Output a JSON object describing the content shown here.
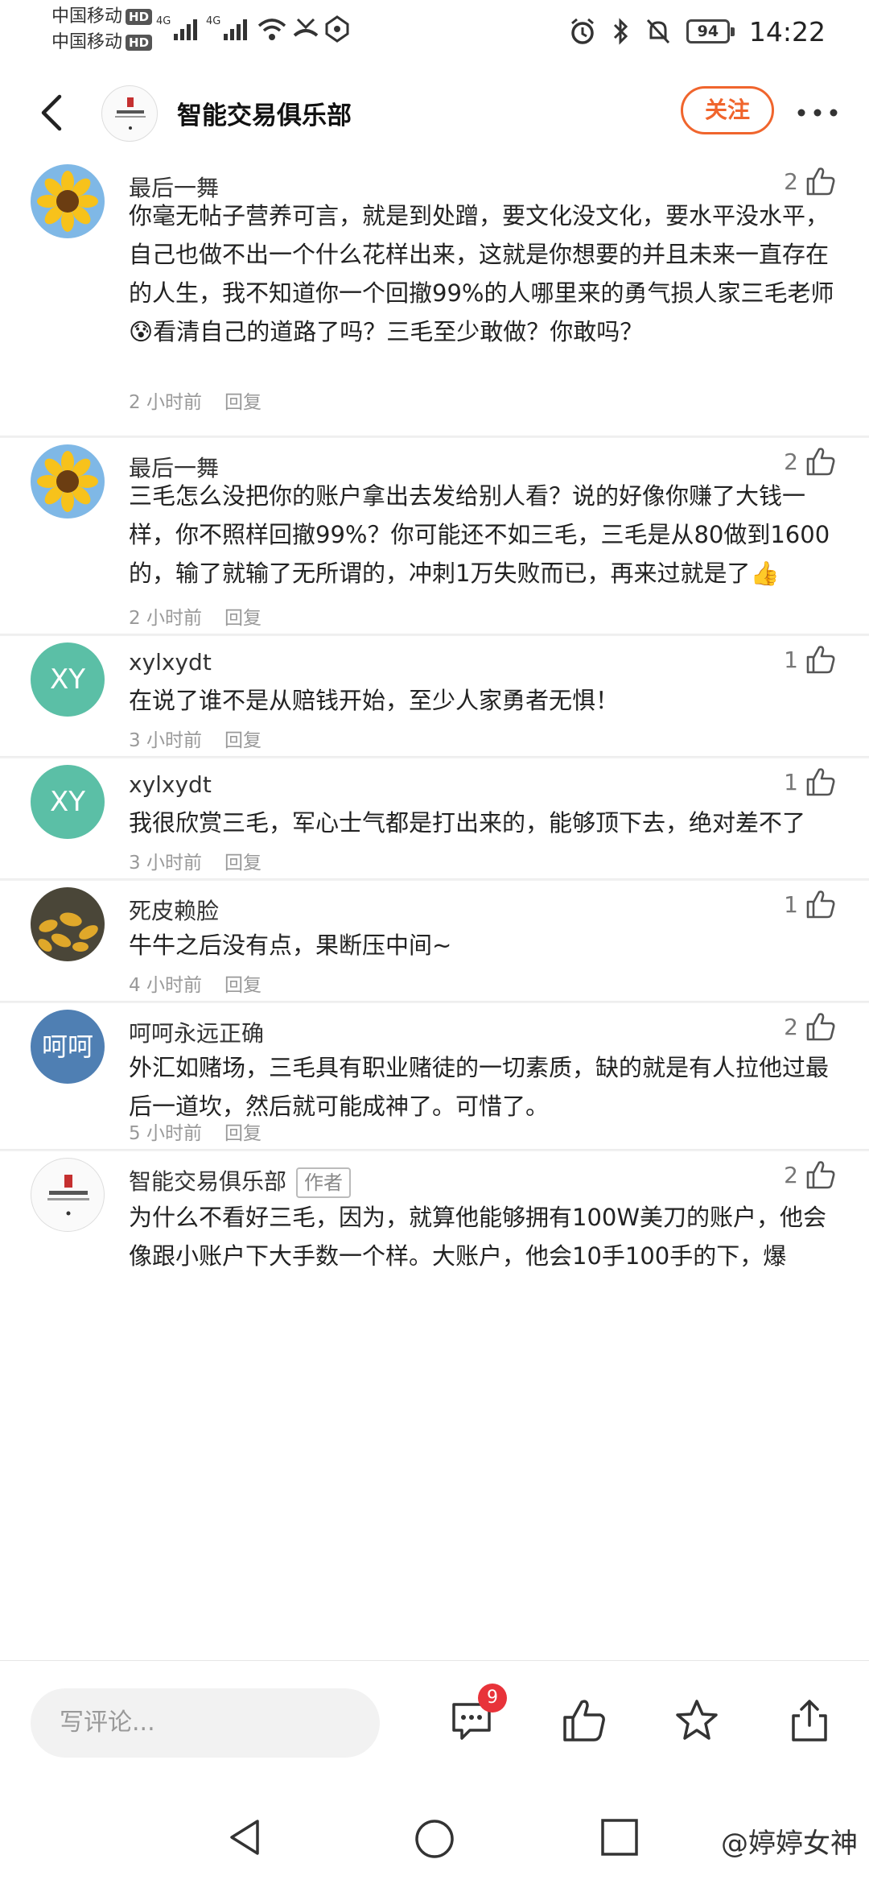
{
  "status_bar": {
    "carrier_1": "中国移动",
    "carrier_2": "中国移动",
    "hd_label": "HD",
    "network_1": "4G",
    "network_2": "4G",
    "battery": "94",
    "time": "14:22"
  },
  "header": {
    "title": "智能交易俱乐部",
    "follow_label": "关注",
    "accent_color": "#f0652d"
  },
  "comments": [
    {
      "user": "最后一舞",
      "likes": "2",
      "text": "你毫无帖子营养可言，就是到处蹭，要文化没文化，要水平没水平，自己也做不出一个什么花样出来，这就是你想要的并且未来一直存在的人生，我不知道你一个回撤99%的人哪里来的勇气损人家三毛老师😰看清自己的道路了吗？三毛至少敢做？你敢吗？",
      "time": "2 小时前",
      "reply": "回复"
    },
    {
      "user": "最后一舞",
      "likes": "2",
      "text": "三毛怎么没把你的账户拿出去发给别人看？说的好像你赚了大钱一样，你不照样回撤99%？你可能还不如三毛，三毛是从80做到1600的，输了就输了无所谓的，冲刺1万失败而已，再来过就是了👍",
      "time": "2 小时前",
      "reply": "回复"
    },
    {
      "user": "xylxydt",
      "avatar_text": "XY",
      "likes": "1",
      "text": "在说了谁不是从赔钱开始，至少人家勇者无惧！",
      "time": "3 小时前",
      "reply": "回复"
    },
    {
      "user": "xylxydt",
      "avatar_text": "XY",
      "likes": "1",
      "text": "我很欣赏三毛，军心士气都是打出来的，能够顶下去，绝对差不了",
      "time": "3 小时前",
      "reply": "回复"
    },
    {
      "user": "死皮赖脸",
      "likes": "1",
      "text": "牛牛之后没有点，果断压中间~",
      "time": "4 小时前",
      "reply": "回复"
    },
    {
      "user": "呵呵永远正确",
      "avatar_text": "呵呵",
      "likes": "2",
      "text": "外汇如赌场，三毛具有职业赌徒的一切素质，缺的就是有人拉他过最后一道坎，然后就可能成神了。可惜了。",
      "time": "5 小时前",
      "reply": "回复"
    },
    {
      "user": "智能交易俱乐部",
      "tag": "作者",
      "likes": "2",
      "text": "为什么不看好三毛，因为，就算他能够拥有100W美刀的账户，他会像跟小账户下大手数一个样。大账户，他会10手100手的下，爆"
    }
  ],
  "bottom_bar": {
    "input_placeholder": "写评论...",
    "comment_badge": "9"
  },
  "navbar": {
    "watermark": "@婷婷女神"
  }
}
